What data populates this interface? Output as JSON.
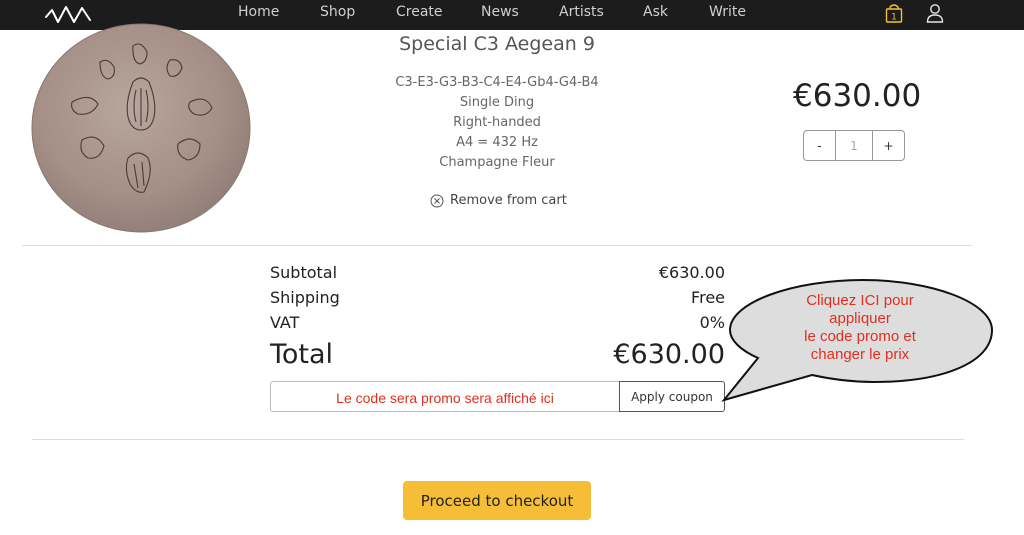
{
  "nav": {
    "items": [
      {
        "label": "Home"
      },
      {
        "label": "Shop"
      },
      {
        "label": "Create"
      },
      {
        "label": "News"
      },
      {
        "label": "Artists"
      },
      {
        "label": "Ask"
      },
      {
        "label": "Write"
      }
    ],
    "cart_count": "1"
  },
  "product": {
    "title": "Special C3 Aegean 9",
    "notes": "C3-E3-G3-B3-C4-E4-Gb4-G4-B4",
    "ding": "Single Ding",
    "hand": "Right-handed",
    "tuning": "A4 = 432 Hz",
    "finish": "Champagne Fleur",
    "remove_label": "Remove from cart",
    "price": "€630.00",
    "quantity": "1",
    "minus_label": "-",
    "plus_label": "+"
  },
  "summary": {
    "subtotal_label": "Subtotal",
    "subtotal_value": "€630.00",
    "shipping_label": "Shipping",
    "shipping_value": "Free",
    "vat_label": "VAT",
    "vat_value": "0%",
    "total_label": "Total",
    "total_value": "€630.00"
  },
  "coupon": {
    "note": "Le code sera  promo sera affiché ici",
    "button_label": "Apply coupon"
  },
  "callout": {
    "line1": "Cliquez ICI pour",
    "line2": "appliquer",
    "line3": "le code promo et",
    "line4": "changer le prix"
  },
  "checkout_label": "Proceed to checkout",
  "colors": {
    "nav_bg": "#1c1c1c",
    "accent_yellow": "#f5be36",
    "annotation_red": "#e0301e"
  }
}
